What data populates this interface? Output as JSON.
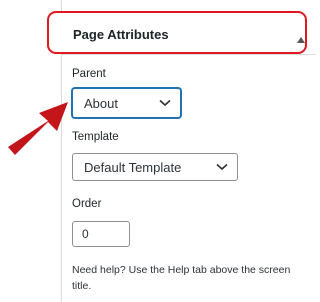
{
  "panel": {
    "title": "Page Attributes",
    "toggle_icon": "triangle-up-icon"
  },
  "parent": {
    "label": "Parent",
    "selected": "About"
  },
  "template": {
    "label": "Template",
    "selected": "Default Template"
  },
  "order": {
    "label": "Order",
    "value": "0"
  },
  "help": {
    "text": "Need help? Use the Help tab above the screen title."
  },
  "colors": {
    "highlight": "#e0181f",
    "focus": "#2271b1",
    "arrow": "#c4151a"
  }
}
